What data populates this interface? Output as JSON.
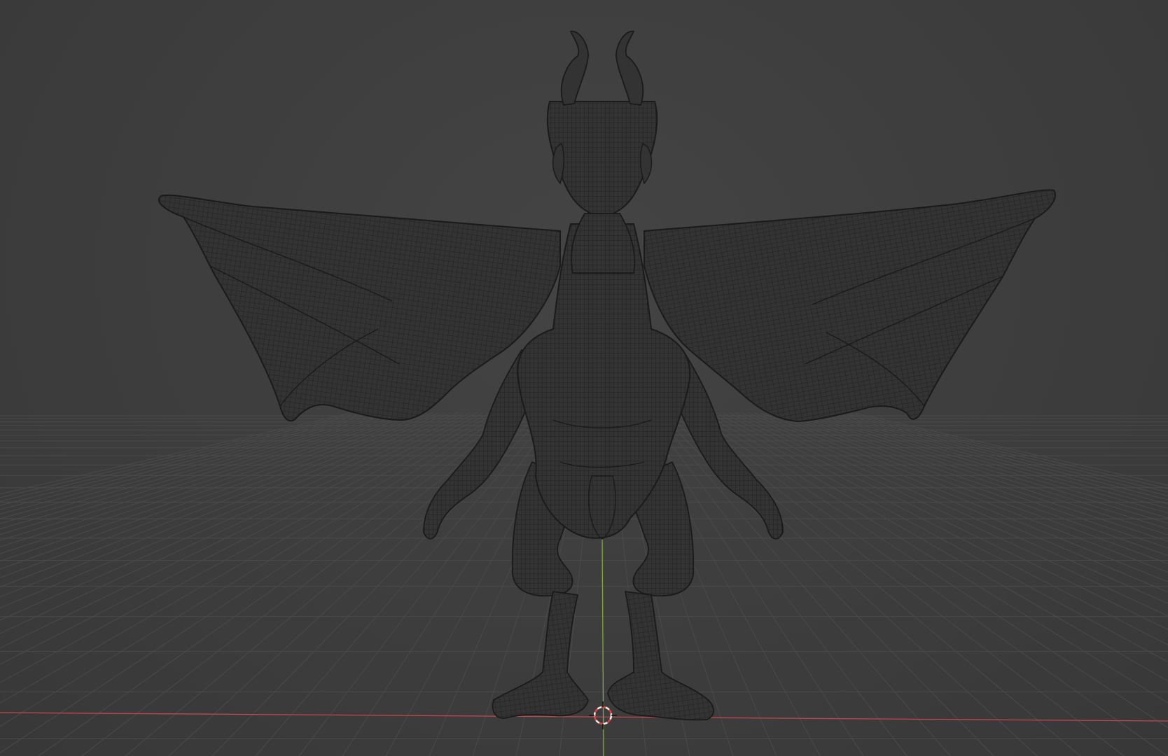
{
  "viewport": {
    "background": "#3d3d3d",
    "grid_color": "#4a4a4a",
    "x_axis_color": "#c0474f",
    "y_axis_color": "#7aab3b",
    "wire_color": "#1a1a1a",
    "mesh_fill": "#333333"
  },
  "scene": {
    "object": "dragon-mesh",
    "display_mode": "wireframe",
    "cursor_colors": {
      "ring_red": "#e04040",
      "ring_white": "#f0f0f0"
    }
  }
}
